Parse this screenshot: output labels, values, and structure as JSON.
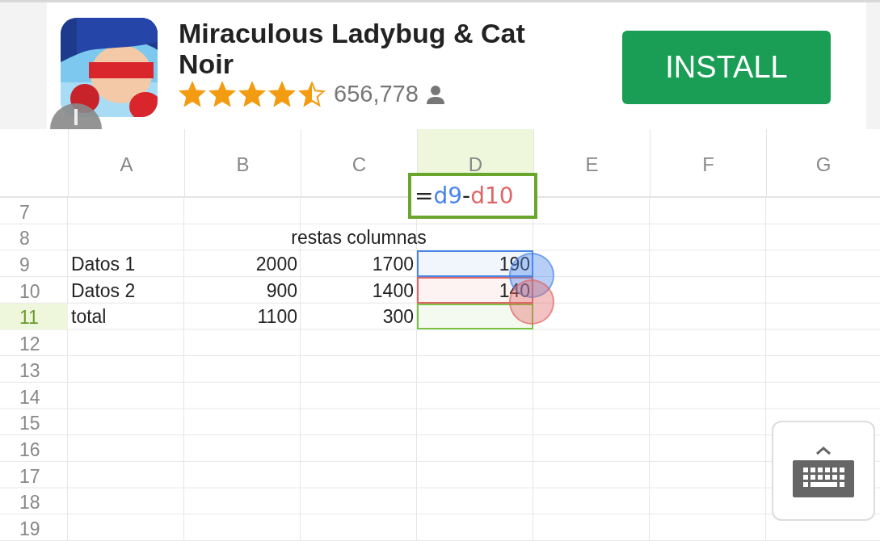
{
  "ad": {
    "kind": "picture",
    "title": "Miraculous Ladybug & Cat Noir",
    "stars": 4.5,
    "rating_count": "656,778",
    "button": "INSTALL"
  },
  "formula": {
    "parts": [
      {
        "text": "=",
        "color": "#222222"
      },
      {
        "text": "d9",
        "color": "#4a86e8"
      },
      {
        "text": "-",
        "color": "#222222"
      },
      {
        "text": "d10",
        "color": "#e06666"
      }
    ]
  },
  "columns": [
    {
      "label": "A",
      "selected": false
    },
    {
      "label": "B",
      "selected": false
    },
    {
      "label": "C",
      "selected": false
    },
    {
      "label": "D",
      "selected": true
    },
    {
      "label": "E",
      "selected": false
    },
    {
      "label": "F",
      "selected": false
    },
    {
      "label": "G",
      "selected": false
    }
  ],
  "rows": [
    {
      "number": "7",
      "selected": false,
      "cells": []
    },
    {
      "number": "8",
      "selected": false,
      "cells": [
        {},
        {},
        {
          "text": "restas columnas",
          "kind": "spanning"
        }
      ]
    },
    {
      "number": "9",
      "selected": false,
      "cells": [
        {
          "text": "Datos 1",
          "kind": "label"
        },
        {
          "text": "2000",
          "kind": "number"
        },
        {
          "text": "1700",
          "kind": "number"
        },
        {
          "text": "190",
          "kind": "number",
          "color": "#4a86e8"
        }
      ]
    },
    {
      "number": "10",
      "selected": false,
      "cells": [
        {
          "text": "Datos 2",
          "kind": "label"
        },
        {
          "text": "900",
          "kind": "number"
        },
        {
          "text": "1400",
          "kind": "number"
        },
        {
          "text": "140",
          "kind": "number",
          "color": "#e06666"
        }
      ]
    },
    {
      "number": "11",
      "selected": true,
      "cells": [
        {
          "text": "total",
          "kind": "label"
        },
        {
          "text": "1100",
          "kind": "number"
        },
        {
          "text": "300",
          "kind": "number"
        },
        {
          "color": "#7cc142"
        }
      ]
    },
    {
      "number": "12",
      "selected": false,
      "cells": []
    },
    {
      "number": "13",
      "selected": false,
      "cells": []
    },
    {
      "number": "14",
      "selected": false,
      "cells": []
    },
    {
      "number": "15",
      "selected": false,
      "cells": []
    },
    {
      "number": "16",
      "selected": false,
      "cells": []
    },
    {
      "number": "17",
      "selected": false,
      "cells": []
    },
    {
      "number": "18",
      "selected": false,
      "cells": []
    },
    {
      "number": "19",
      "selected": false,
      "cells": []
    }
  ]
}
